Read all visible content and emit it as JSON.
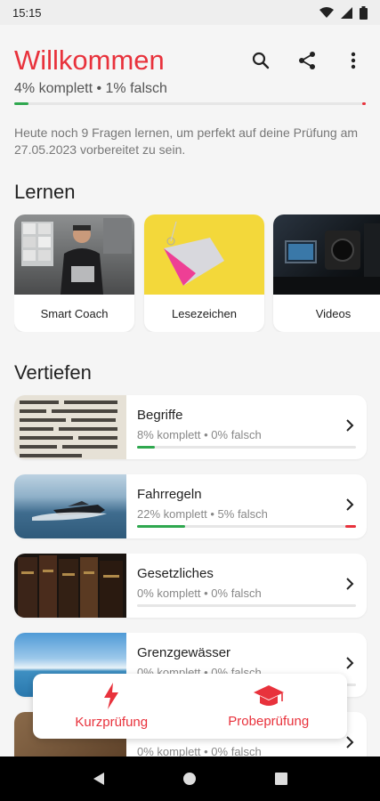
{
  "status_bar": {
    "time": "15:15"
  },
  "header": {
    "title": "Willkommen",
    "subtitle": "4% komplett • 1% falsch",
    "progress": {
      "complete_percent": 4,
      "wrong_percent": 1
    },
    "actions": [
      "search-icon",
      "share-icon",
      "more-vertical-icon"
    ]
  },
  "info_text": "Heute noch 9 Fragen lernen, um perfekt auf deine Prüfung am 27.05.2023 vorbereitet zu sein.",
  "learn": {
    "title": "Lernen",
    "cards": [
      {
        "label": "Smart Coach"
      },
      {
        "label": "Lesezeichen"
      },
      {
        "label": "Videos"
      }
    ]
  },
  "deepen": {
    "title": "Vertiefen",
    "topics": [
      {
        "name": "Begriffe",
        "stats": "8% komplett • 0% falsch",
        "complete_percent": 8,
        "wrong_percent": 0
      },
      {
        "name": "Fahrregeln",
        "stats": "22% komplett • 5% falsch",
        "complete_percent": 22,
        "wrong_percent": 5
      },
      {
        "name": "Gesetzliches",
        "stats": "0% komplett • 0% falsch",
        "complete_percent": 0,
        "wrong_percent": 0
      },
      {
        "name": "Grenzgewässer",
        "stats": "0% komplett • 0% falsch",
        "complete_percent": 0,
        "wrong_percent": 0
      },
      {
        "name": "",
        "stats": "0% komplett • 0% falsch",
        "complete_percent": 0,
        "wrong_percent": 0
      }
    ]
  },
  "exam_panel": {
    "short_exam": "Kurzprüfung",
    "mock_exam": "Probeprüfung"
  },
  "colors": {
    "accent": "#e8323c",
    "complete": "#2fa84f",
    "wrong": "#e8323c"
  }
}
